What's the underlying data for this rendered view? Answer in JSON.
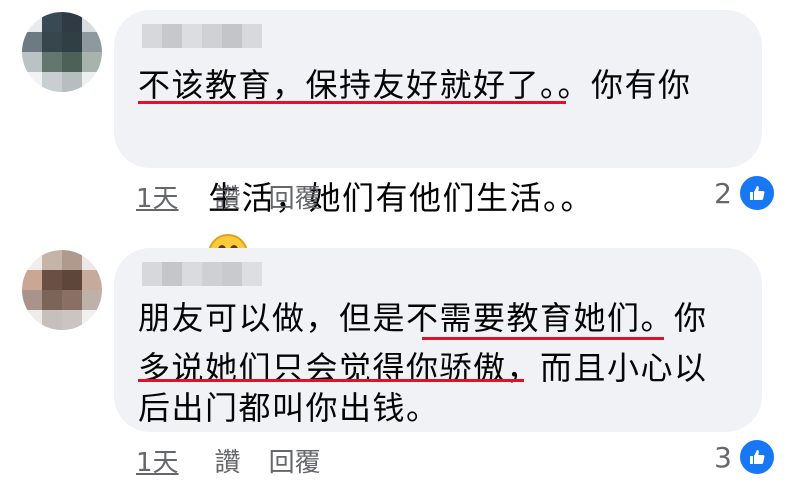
{
  "comments": [
    {
      "lines": [
        "不该教育，保持友好就好了。。你有你",
        "生活，她们有他们生活。。"
      ],
      "emoji": "grinning-face-icon",
      "time": "1天",
      "action1": "讚",
      "action2": "回覆",
      "reaction_count": "2"
    },
    {
      "lines": [
        "朋友可以做，但是不需要教育她们。你",
        "多说她们只会觉得你骄傲，而且小心以",
        "后出门都叫你出钱。"
      ],
      "time": "1天",
      "action1": "讚",
      "action2": "回覆",
      "reaction_count": "3"
    }
  ],
  "colors": {
    "bubble": "#f0f2f5",
    "underline": "#e0112b",
    "like": "#1877f2",
    "meta": "#65676b"
  }
}
